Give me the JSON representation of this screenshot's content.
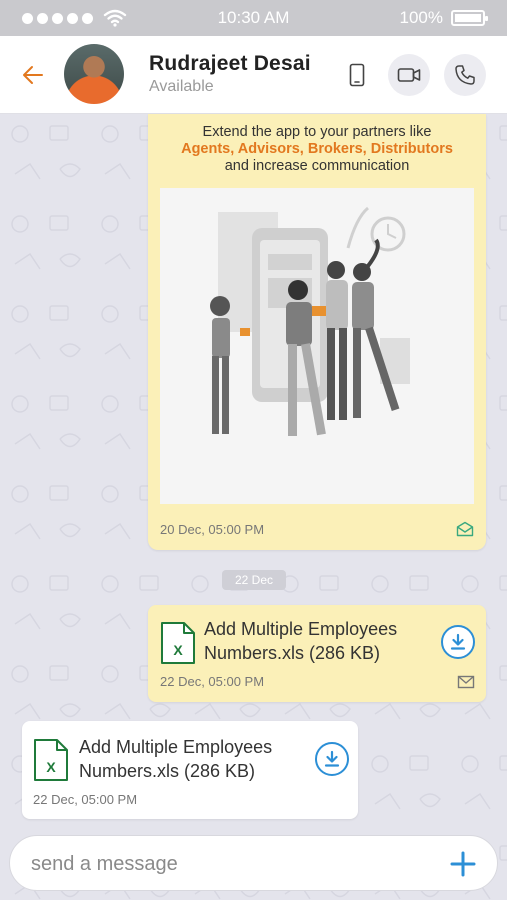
{
  "status_bar": {
    "time": "10:30 AM",
    "battery": "100%"
  },
  "header": {
    "contact_name": "Rudrajeet Desai",
    "contact_status": "Available"
  },
  "messages": {
    "promo": {
      "line1": "Extend the app to your partners like",
      "line2": "Agents, Advisors, Brokers, Distributors",
      "line3": "and increase communication",
      "time": "20 Dec, 05:00 PM"
    },
    "date_separator": "22 Dec",
    "file_out": {
      "name_line1": "Add Multiple Employees",
      "name_line2": "Numbers.xls (286 KB)",
      "time": "22 Dec, 05:00 PM"
    },
    "file_in": {
      "name_line1": "Add Multiple Employees",
      "name_line2": "Numbers.xls (286 KB)",
      "time": "22 Dec, 05:00 PM"
    }
  },
  "composer": {
    "placeholder": "send a message",
    "value": ""
  },
  "colors": {
    "accent_orange": "#e2781f",
    "outgoing_bubble": "#fbf0b8",
    "download_blue": "#2c8fd6",
    "excel_green": "#1f7a3a"
  }
}
